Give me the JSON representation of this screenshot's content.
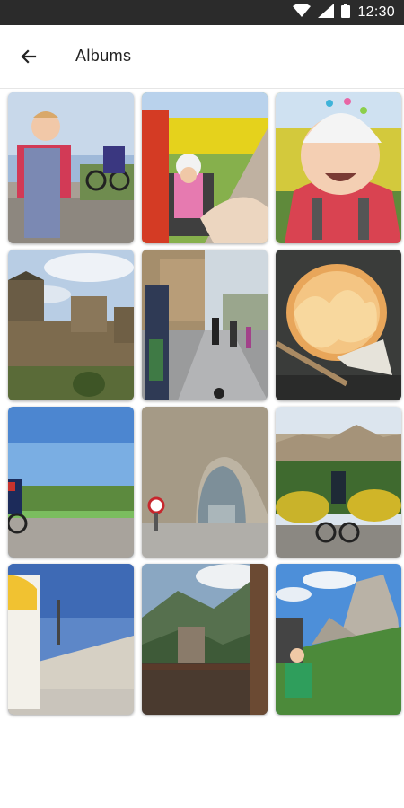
{
  "status_bar": {
    "time": "12:30",
    "icons": [
      "wifi-icon",
      "signal-icon",
      "battery-icon"
    ]
  },
  "app_bar": {
    "back_icon": "arrow-left-icon",
    "title": "Albums"
  },
  "grid": {
    "rows": 4,
    "columns": 3
  },
  "colors": {
    "status_bar": "#2b2b2b",
    "background": "#ffffff"
  }
}
